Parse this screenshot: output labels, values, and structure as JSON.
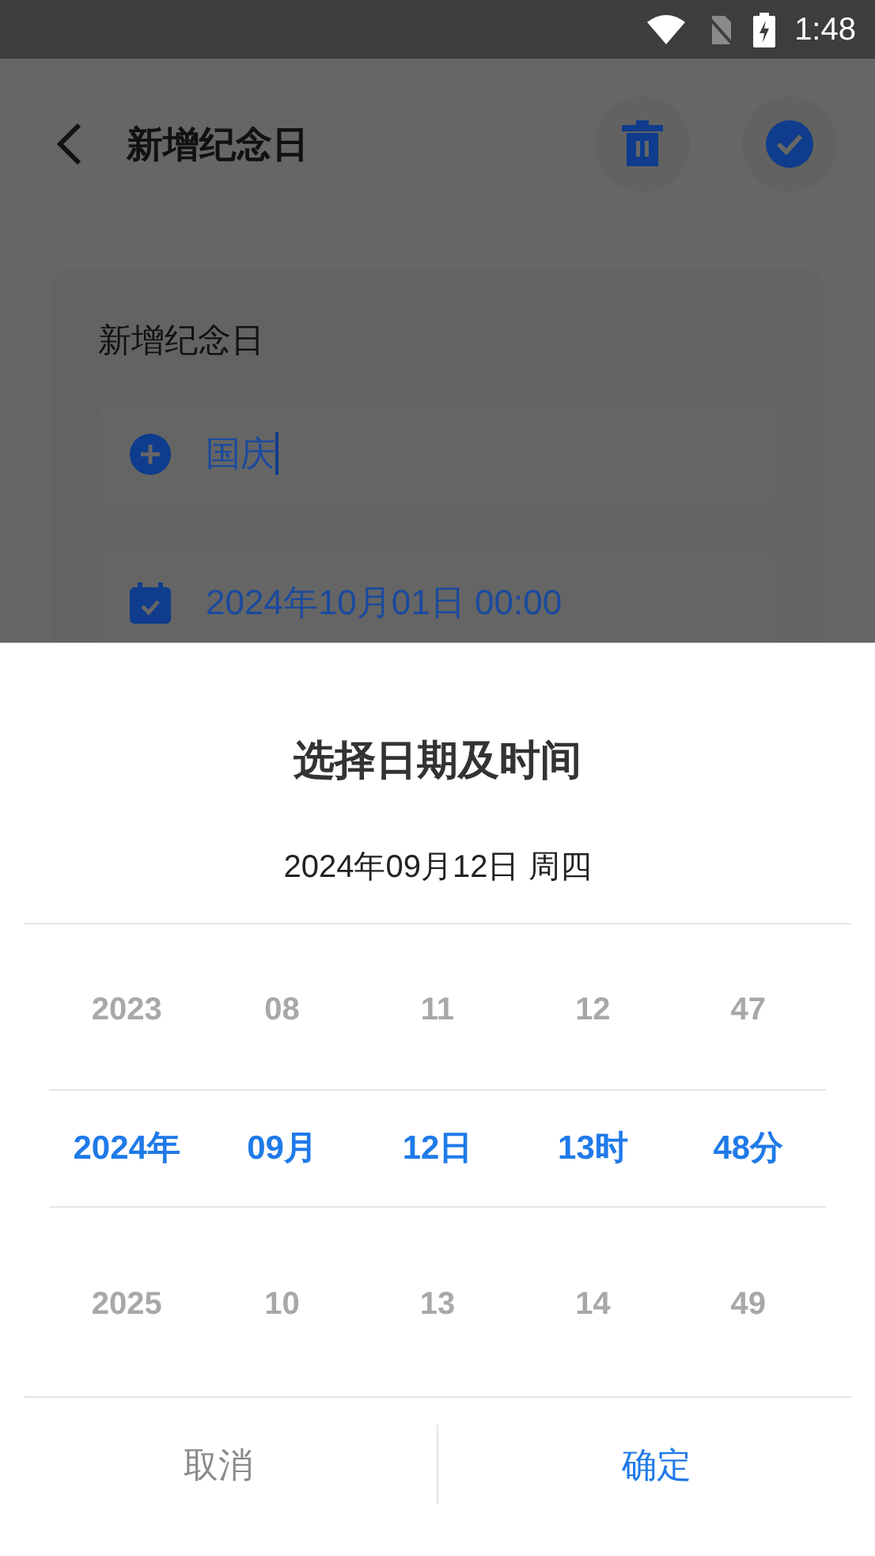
{
  "status_bar": {
    "time": "1:48"
  },
  "app_bar": {
    "title": "新增纪念日"
  },
  "card": {
    "label": "新增纪念日",
    "name_field": {
      "value": "国庆",
      "focused": true
    },
    "date_field": {
      "value": "2024年10月01日 00:00"
    }
  },
  "dialog": {
    "title": "选择日期及时间",
    "current": "2024年09月12日 周四",
    "columns": [
      {
        "items": [
          {
            "label": "2023",
            "selected": false
          },
          {
            "label": "2024年",
            "selected": true
          },
          {
            "label": "2025",
            "selected": false
          }
        ]
      },
      {
        "items": [
          {
            "label": "08",
            "selected": false
          },
          {
            "label": "09月",
            "selected": true
          },
          {
            "label": "10",
            "selected": false
          }
        ]
      },
      {
        "items": [
          {
            "label": "11",
            "selected": false
          },
          {
            "label": "12日",
            "selected": true
          },
          {
            "label": "13",
            "selected": false
          }
        ]
      },
      {
        "items": [
          {
            "label": "12",
            "selected": false
          },
          {
            "label": "13时",
            "selected": true
          },
          {
            "label": "14",
            "selected": false
          }
        ]
      },
      {
        "items": [
          {
            "label": "47",
            "selected": false
          },
          {
            "label": "48分",
            "selected": true
          },
          {
            "label": "49",
            "selected": false
          }
        ]
      }
    ],
    "buttons": [
      {
        "label": "取消",
        "kind": "cancel"
      },
      {
        "label": "确定",
        "kind": "confirm"
      }
    ]
  }
}
